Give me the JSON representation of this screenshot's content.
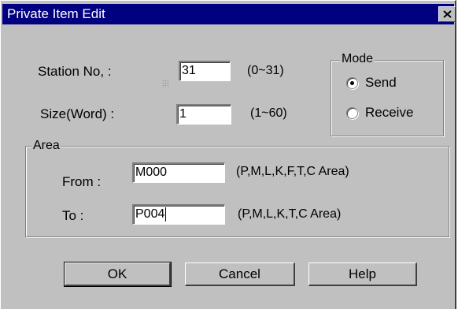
{
  "window": {
    "title": "Private Item Edit"
  },
  "station": {
    "label": "Station No, :",
    "value": "31",
    "range": "(0~31)"
  },
  "size": {
    "label": "Size(Word) :",
    "value": "1",
    "range": "(1~60)"
  },
  "mode": {
    "title": "Mode",
    "options": [
      {
        "label": "Send",
        "selected": true
      },
      {
        "label": "Receive",
        "selected": false
      }
    ]
  },
  "area": {
    "title": "Area",
    "from": {
      "label": "From :",
      "value": "M000",
      "hint": "(P,M,L,K,F,T,C Area)"
    },
    "to": {
      "label": "To :",
      "value": "P004",
      "hint": "(P,M,L,K,T,C Area)"
    }
  },
  "buttons": {
    "ok": "OK",
    "cancel": "Cancel",
    "help": "Help"
  },
  "colors": {
    "titlebar": "#000080",
    "face": "#c0c0c0"
  },
  "icons": {
    "close": "close-icon"
  }
}
